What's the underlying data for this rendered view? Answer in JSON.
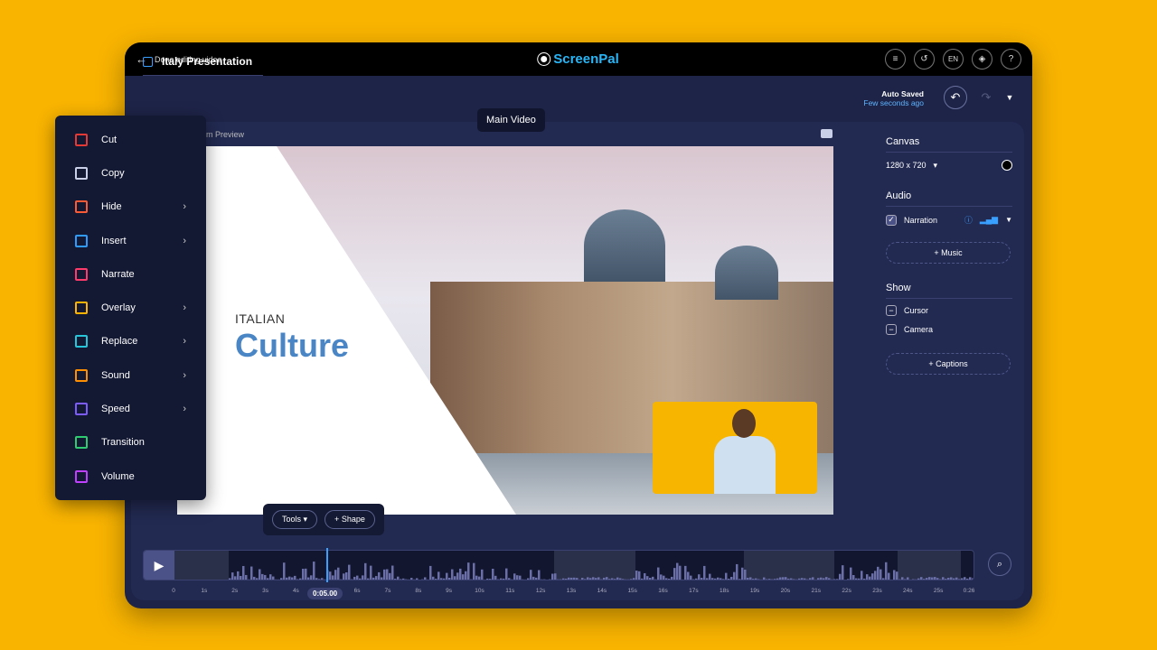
{
  "topbar": {
    "back_label": "Done editing video",
    "logo": "ScreenPal",
    "icons": [
      "checklist-icon",
      "history-icon",
      "language-icon",
      "layers-icon",
      "help-icon"
    ],
    "language": "EN",
    "help": "?"
  },
  "project": {
    "title": "Italy Presentation",
    "save_status": "Auto Saved",
    "save_time": "Few seconds ago"
  },
  "preview": {
    "label": "om Preview",
    "tooltip": "Main Video",
    "slide_small": "ITALIAN",
    "slide_big": "Culture"
  },
  "tools": {
    "tools_label": "Tools",
    "shape_label": "Shape"
  },
  "side": {
    "canvas_heading": "Canvas",
    "canvas_size": "1280 x 720",
    "audio_heading": "Audio",
    "narration": "Narration",
    "music": "Music",
    "show_heading": "Show",
    "cursor": "Cursor",
    "camera": "Camera",
    "captions": "Captions"
  },
  "timeline": {
    "current_time": "0:05.00",
    "progress_percent": 19.2,
    "ticks": [
      "0",
      "1s",
      "2s",
      "3s",
      "4s",
      "5s",
      "6s",
      "7s",
      "8s",
      "9s",
      "10s",
      "11s",
      "12s",
      "13s",
      "14s",
      "15s",
      "16s",
      "17s",
      "18s",
      "19s",
      "20s",
      "21s",
      "22s",
      "23s",
      "24s",
      "25s",
      "0:26"
    ]
  },
  "menu": [
    {
      "label": "Cut",
      "icon": "scissors-icon",
      "color": "#e53935",
      "sub": false
    },
    {
      "label": "Copy",
      "icon": "copy-icon",
      "color": "#c8cfe6",
      "sub": false
    },
    {
      "label": "Hide",
      "icon": "eye-off-icon",
      "color": "#ff5a36",
      "sub": true
    },
    {
      "label": "Insert",
      "icon": "insert-icon",
      "color": "#2f9bff",
      "sub": true
    },
    {
      "label": "Narrate",
      "icon": "microphone-icon",
      "color": "#ff3b6b",
      "sub": false
    },
    {
      "label": "Overlay",
      "icon": "layers-icon",
      "color": "#ffb300",
      "sub": true
    },
    {
      "label": "Replace",
      "icon": "replace-icon",
      "color": "#26c6da",
      "sub": true
    },
    {
      "label": "Sound",
      "icon": "sound-wave-icon",
      "color": "#ff8f00",
      "sub": true
    },
    {
      "label": "Speed",
      "icon": "fast-forward-icon",
      "color": "#7c5cff",
      "sub": true
    },
    {
      "label": "Transition",
      "icon": "transition-icon",
      "color": "#2ecc71",
      "sub": false
    },
    {
      "label": "Volume",
      "icon": "volume-icon",
      "color": "#c040ff",
      "sub": false
    }
  ]
}
